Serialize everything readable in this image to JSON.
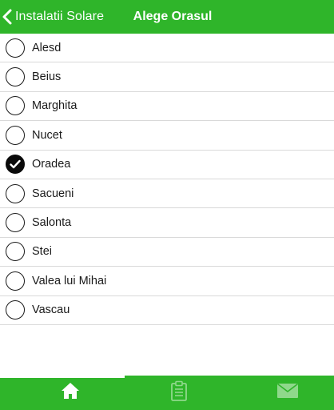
{
  "header": {
    "back_label": "Instalatii Solare",
    "title": "Alege Orasul"
  },
  "cities": [
    {
      "name": "Alesd",
      "selected": false
    },
    {
      "name": "Beius",
      "selected": false
    },
    {
      "name": "Marghita",
      "selected": false
    },
    {
      "name": "Nucet",
      "selected": false
    },
    {
      "name": "Oradea",
      "selected": true
    },
    {
      "name": "Sacueni",
      "selected": false
    },
    {
      "name": "Salonta",
      "selected": false
    },
    {
      "name": "Stei",
      "selected": false
    },
    {
      "name": "Valea lui Mihai",
      "selected": false
    },
    {
      "name": "Vascau",
      "selected": false
    }
  ],
  "tabbar": {
    "tabs": [
      {
        "icon": "home-icon",
        "active": true
      },
      {
        "icon": "clipboard-icon",
        "active": false
      },
      {
        "icon": "mail-icon",
        "active": false
      }
    ]
  },
  "colors": {
    "brand_green": "#2fb52a",
    "text": "#1a1a1a",
    "divider": "#d9d9d9"
  }
}
